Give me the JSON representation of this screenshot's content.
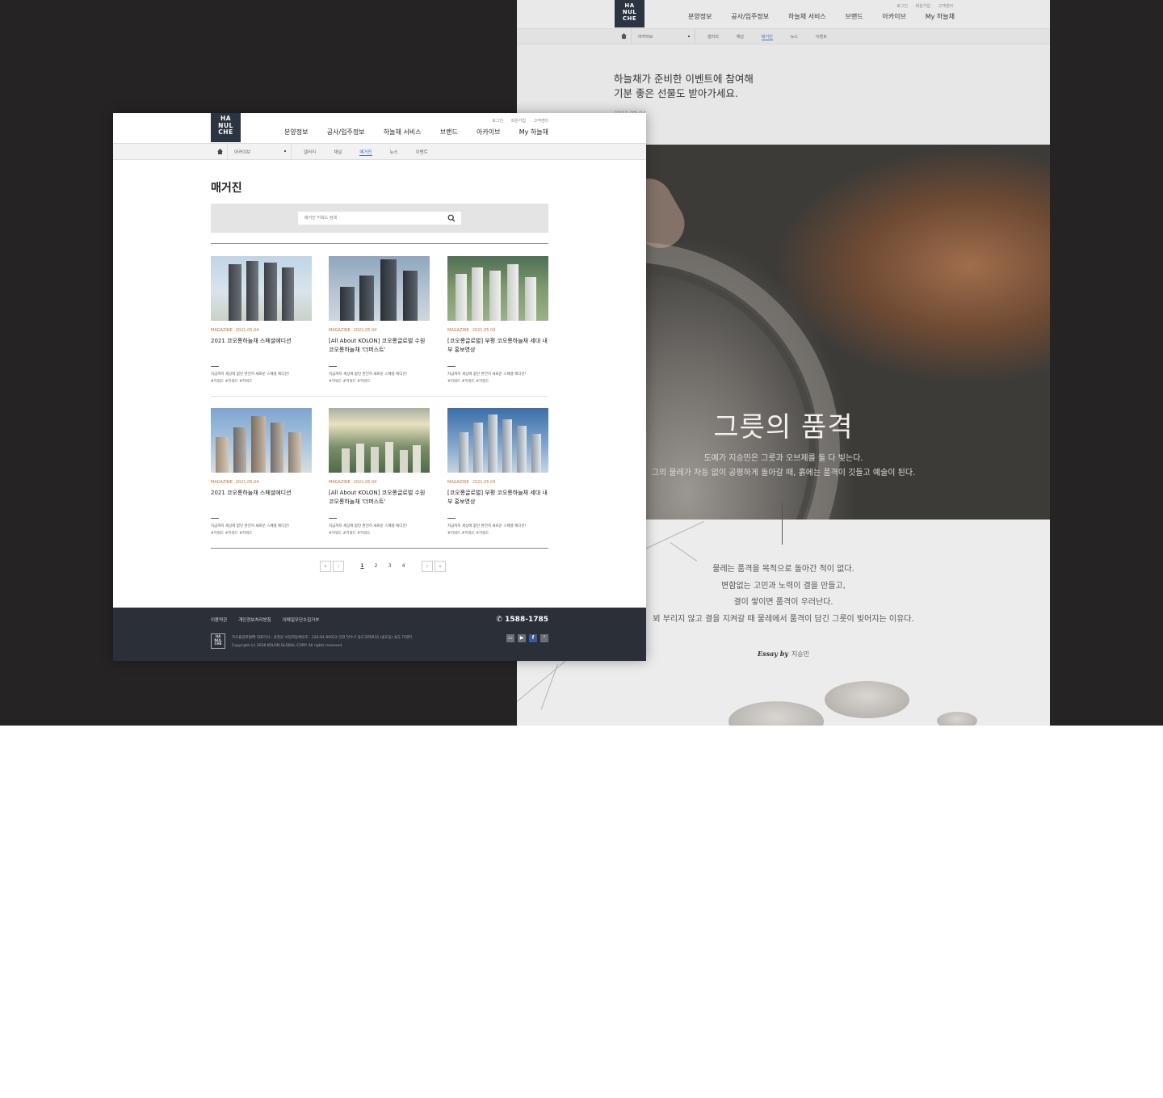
{
  "brand": {
    "logo_lines": [
      "HA",
      "NUL",
      "CHE"
    ]
  },
  "util_links": [
    "로그인",
    "회원가입",
    "고객센터"
  ],
  "gnav": [
    "분양정보",
    "공사/입주정보",
    "하늘채 서비스",
    "브랜드",
    "아카이브",
    "My 하늘채"
  ],
  "lnb": {
    "select_label": "아카이브",
    "items": [
      "갤러리",
      "채널",
      "매거진",
      "뉴스",
      "이벤트"
    ],
    "active": "매거진"
  },
  "back_page": {
    "lnb_items": [
      "갤러리",
      "채널",
      "매거진",
      "뉴스",
      "이벤트"
    ],
    "intro_line1": "하늘채가 준비한 이벤트에 참여해",
    "intro_line2": "기분 좋은 선물도 받아가세요.",
    "date": "2021.05.04",
    "hero_title": "그릇의 품격",
    "hero_sub1": "도예가 지승민은 그릇과 오브제를 둘 다 빚는다.",
    "hero_sub2": "그의 물레가 차등 없이 공평하게 돌아갈 때, 흙에는 품격이 깃들고 예술이 된다.",
    "essay": [
      "물레는 품격을 목적으로 돌아간 적이 없다.",
      "변함없는 고민과 노력이 결을 만들고,",
      "결이 쌓이면 품격이 우러난다.",
      "뵈 부리지 않고 결을 지켜갈 때 물레에서 품격이 담긴 그릇이 빚어지는 이유다."
    ],
    "essay_by_label": "Essay by",
    "essay_by_name": "지승민"
  },
  "page": {
    "title": "매거진",
    "search_placeholder": "매거진 키워드 검색"
  },
  "cards": [
    {
      "category": "MAGAZINE",
      "date": "2021.05.04",
      "title": "2021 코오롱하늘채 스페셜에디션",
      "desc1": "지금까지 세상에 없던 완전히 새로운 스페셜 에디션!",
      "desc2": "#키워드 #키워드 #키워드"
    },
    {
      "category": "MAGAZINE",
      "date": "2021.05.04",
      "title": "[All About KOLON] 코오롱글로벌 수원 코오롱하늘채 '더퍼스트'",
      "desc1": "지금까지 세상에 없던 완전히 새로운 스페셜 에디션!",
      "desc2": "#키워드 #키워드 #키워드"
    },
    {
      "category": "MAGAZINE",
      "date": "2021.05.04",
      "title": "[코오롱글로벌] 부평 코오롱하늘채 세대 내부 홍보영상",
      "desc1": "지금까지 세상에 없던 완전히 새로운 스페셜 에디션!",
      "desc2": "#키워드 #키워드 #키워드"
    },
    {
      "category": "MAGAZINE",
      "date": "2021.05.04",
      "title": "2021 코오롱하늘채 스페셜에디션",
      "desc1": "지금까지 세상에 없던 완전히 새로운 스페셜 에디션!",
      "desc2": "#키워드 #키워드 #키워드"
    },
    {
      "category": "MAGAZINE",
      "date": "2021.05.04",
      "title": "[All About KOLON] 코오롱글로벌 수원 코오롱하늘채 '더퍼스트'",
      "desc1": "지금까지 세상에 없던 완전히 새로운 스페셜 에디션!",
      "desc2": "#키워드 #키워드 #키워드"
    },
    {
      "category": "MAGAZINE",
      "date": "2021.05.04",
      "title": "[코오롱글로벌] 부평 코오롱하늘채 세대 내부 홍보영상",
      "desc1": "지금까지 세상에 없던 완전히 새로운 스페셜 에디션!",
      "desc2": "#키워드 #키워드 #키워드"
    }
  ],
  "pagination": {
    "first": "«",
    "prev": "‹",
    "pages": [
      "1",
      "2",
      "3",
      "4"
    ],
    "current": "1",
    "next": "›",
    "last": "»"
  },
  "footer": {
    "links": [
      "이용약관",
      "개인정보처리방침",
      "이메일무단수집거부"
    ],
    "phone": "1588-1785",
    "info": "코오롱글로벌㈜   대표이사 : 윤창운   사업자등록번호 : 120-81-00012   인천 연수구 송도과학로32 (송도동) 송도 IT센터",
    "copyright": "Copyright (c) 2018 KOLON GLOBAL CORP. All rights reserved.",
    "sns": [
      "blog-icon",
      "youtube-icon",
      "facebook-icon",
      "kakao-icon"
    ]
  },
  "colors": {
    "brand_navy": "#2b3441",
    "accent_orange": "#c0733b",
    "active_blue": "#3a77b5",
    "footer_bg": "#2b2f38"
  }
}
